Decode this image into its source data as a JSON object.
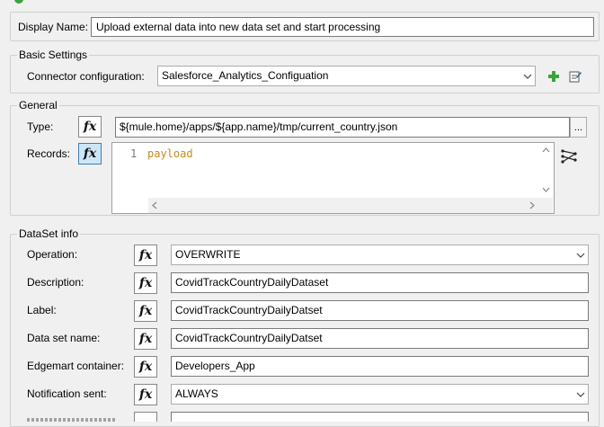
{
  "display_name": {
    "label": "Display Name:",
    "value": "Upload external data into new data set and start processing"
  },
  "basic_settings": {
    "legend": "Basic Settings",
    "connector_label": "Connector configuration:",
    "connector_value": "Salesforce_Analytics_Configuation",
    "add_icon": "plus-icon",
    "edit_icon": "edit-icon"
  },
  "general": {
    "legend": "General",
    "type_label": "Type:",
    "type_value": "${mule.home}/apps/${app.name}/tmp/current_country.json",
    "type_ellipsis": "...",
    "records_label": "Records:",
    "records_line_number": "1",
    "records_code": "payload",
    "fx_label": "fx",
    "mapping_icon": "datamapper-icon"
  },
  "dataset_info": {
    "legend": "DataSet info",
    "operation_label": "Operation:",
    "operation_value": "OVERWRITE",
    "description_label": "Description:",
    "description_value": "CovidTrackCountryDailyDataset",
    "label_label": "Label:",
    "label_value": "CovidTrackCountryDailyDatset",
    "dataset_name_label": "Data set name:",
    "dataset_name_value": "CovidTrackCountryDailyDatset",
    "edgemart_label": "Edgemart container:",
    "edgemart_value": "Developers_App",
    "notification_label": "Notification sent:",
    "notification_value": "ALWAYS",
    "fx_label": "fx"
  },
  "colors": {
    "code_keyword": "#c68a1f",
    "fx_active_bg": "#cde6f7",
    "plus_green": "#3aa53a"
  }
}
